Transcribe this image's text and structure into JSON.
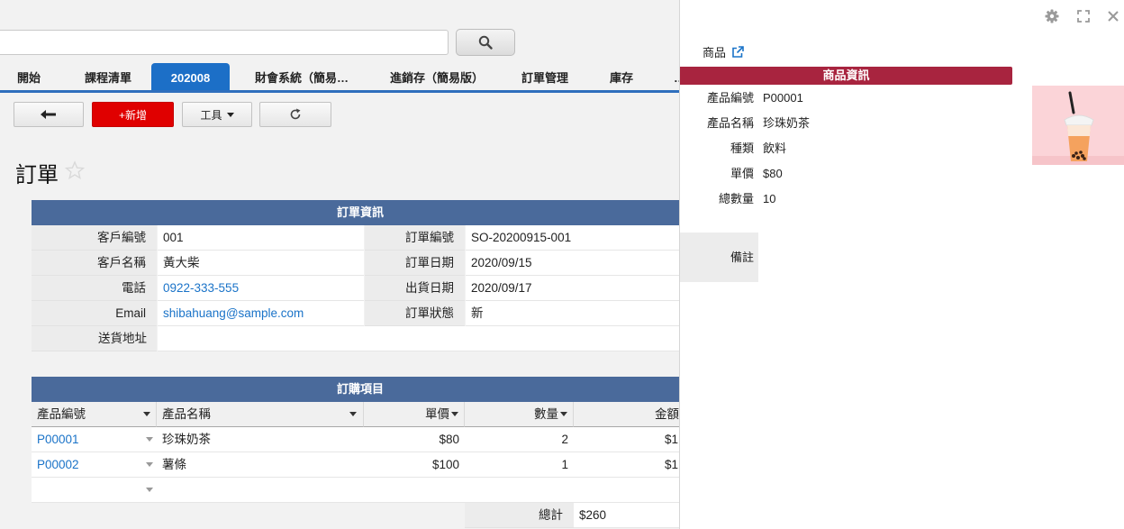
{
  "tabs": [
    "開始",
    "課程清單",
    "202008",
    "財會系統（簡易…",
    "進銷存（簡易版）",
    "訂單管理",
    "庫存",
    "…"
  ],
  "toolbar": {
    "back_icon": "arrow-left-icon",
    "add_label": "+新增",
    "tools_label": "工具",
    "refresh_icon": "redo-icon"
  },
  "page": {
    "title": "訂單"
  },
  "order_info": {
    "header": "訂單資訊",
    "customer_id_label": "客戶編號",
    "customer_id": "001",
    "customer_name_label": "客戶名稱",
    "customer_name": "黃大柴",
    "phone_label": "電話",
    "phone": "0922-333-555",
    "email_label": "Email",
    "email": "shibahuang@sample.com",
    "address_label": "送貨地址",
    "address": "",
    "order_no_label": "訂單編號",
    "order_no": "SO-20200915-001",
    "order_date_label": "訂單日期",
    "order_date": "2020/09/15",
    "ship_date_label": "出貨日期",
    "ship_date": "2020/09/17",
    "status_label": "訂單狀態",
    "status": "新"
  },
  "items": {
    "header": "訂購項目",
    "columns": [
      "產品編號",
      "產品名稱",
      "單價",
      "數量",
      "金額"
    ],
    "rows": [
      {
        "id": "P00001",
        "name": "珍珠奶茶",
        "price": "$80",
        "qty": "2",
        "amount": "$1"
      },
      {
        "id": "P00002",
        "name": "薯條",
        "price": "$100",
        "qty": "1",
        "amount": "$1"
      }
    ],
    "total_label": "總計",
    "total": "$260"
  },
  "panel": {
    "title": "商品",
    "section": "商品資訊",
    "fields": [
      {
        "label": "產品編號",
        "value": "P00001"
      },
      {
        "label": "產品名稱",
        "value": "珍珠奶茶"
      },
      {
        "label": "種類",
        "value": "飲料"
      },
      {
        "label": "單價",
        "value": "$80"
      },
      {
        "label": "總數量",
        "value": "10"
      }
    ],
    "note_label": "備註",
    "note": "",
    "icons": [
      "gear-icon",
      "expand-icon",
      "close-icon"
    ]
  },
  "colors": {
    "accent": "#1c6fc7",
    "section": "#4a6a9b",
    "panel_section": "#a8243f",
    "add_button": "#e00000"
  }
}
